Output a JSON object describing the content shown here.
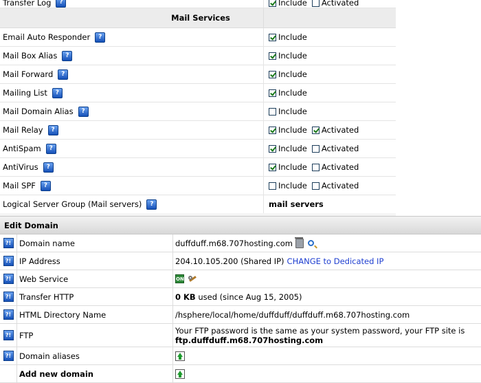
{
  "mail_services": {
    "partial_row": {
      "name": "Transfer Log",
      "include_label": "Include",
      "activated_label": "Activated"
    },
    "title": "Mail Services",
    "rows": [
      {
        "name": "Email Auto Responder",
        "include": true,
        "include_label": "Include"
      },
      {
        "name": "Mail Box Alias",
        "include": true,
        "include_label": "Include"
      },
      {
        "name": "Mail Forward",
        "include": true,
        "include_label": "Include"
      },
      {
        "name": "Mailing List",
        "include": true,
        "include_label": "Include"
      },
      {
        "name": "Mail Domain Alias",
        "include": false,
        "include_label": "Include"
      },
      {
        "name": "Mail Relay",
        "include": true,
        "include_label": "Include",
        "activated": true,
        "activated_label": "Activated"
      },
      {
        "name": "AntiSpam",
        "include": true,
        "include_label": "Include",
        "activated": false,
        "activated_label": "Activated"
      },
      {
        "name": "AntiVirus",
        "include": true,
        "include_label": "Include",
        "activated": false,
        "activated_label": "Activated"
      },
      {
        "name": "Mail SPF",
        "include": false,
        "include_label": "Include",
        "activated": false,
        "activated_label": "Activated"
      }
    ],
    "logical_group": {
      "name": "Logical Server Group (Mail servers)",
      "value": "mail servers"
    }
  },
  "edit_domain": {
    "title": "Edit Domain",
    "domain_name": {
      "label": "Domain name",
      "value": "duffduff.m68.707hosting.com"
    },
    "ip_address": {
      "label": "IP Address",
      "value": "204.10.105.200 (Shared IP)",
      "link": "CHANGE to Dedicated IP"
    },
    "web_service": {
      "label": "Web Service",
      "on_icon_text": "ON"
    },
    "transfer_http": {
      "label": "Transfer HTTP",
      "value_bold": "0 KB",
      "value_rest": " used (since Aug 15, 2005)"
    },
    "html_directory": {
      "label": "HTML Directory Name",
      "value": "/hsphere/local/home/duffduff/duffduff.m68.707hosting.com"
    },
    "ftp": {
      "label": "FTP",
      "line1": "Your FTP password is the same as your system password, your FTP site is",
      "line2": "ftp.duffduff.m68.707hosting.com"
    },
    "domain_aliases": {
      "label": "Domain aliases"
    },
    "add_new_domain": {
      "label": "Add new domain"
    }
  },
  "icons": {
    "help": "help-icon",
    "trash": "trash-icon",
    "magnifier": "magnifier-icon",
    "on": "on-icon",
    "wrench": "wrench-icon",
    "add": "add-icon"
  },
  "colors": {
    "link": "#1f3fd0",
    "header_bg": "#ececec",
    "help_icon": "#1550b8",
    "check_green": "#1a7a1a"
  }
}
